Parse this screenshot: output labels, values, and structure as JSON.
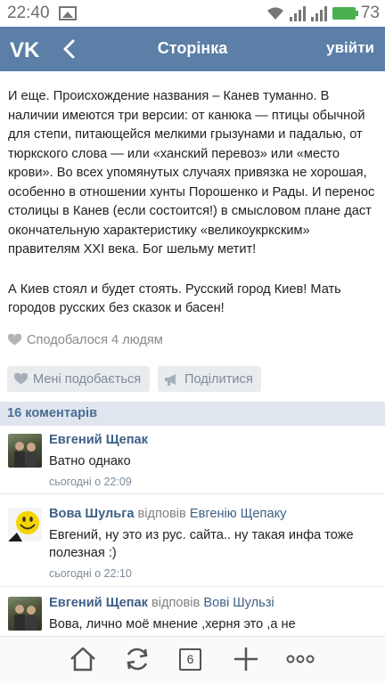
{
  "status_bar": {
    "time": "22:40",
    "battery": "73",
    "icons": [
      "image-icon",
      "wifi-icon",
      "signal-icon",
      "signal-icon",
      "battery-icon"
    ]
  },
  "navbar": {
    "title": "Сторінка",
    "login": "увійти",
    "accent": "#5b7fa6"
  },
  "post": {
    "paragraphs": [
      "И еще. Происхождение названия – Канев туманно. В наличии имеются три версии: от канюка — птицы обычной для степи, питающейся мелкими грызунами и падалью, от тюркского слова — или «ханский перевоз» или «место крови». Во всех упомянутых случаях привязка не хорошая, особенно в отношении хунты Порошенко и Рады. И перенос столицы в Канев (если состоится!) в смысловом плане даст окончательную характеристику «великоукркским» правителям XXI века. Бог шельму метит!",
      "А Киев стоял и будет стоять. Русский город Киев! Мать городов русских без сказок и басен!"
    ],
    "likes_text": "Сподобалося 4 людям"
  },
  "actions": {
    "like_label": "Мені подобається",
    "share_label": "Поділитися"
  },
  "comments": {
    "header": "16 коментарів",
    "items": [
      {
        "author": "Евгений Щепак",
        "reply_word": "",
        "reply_to": "",
        "text": "Ватно однако",
        "time": "сьогодні о 22:09"
      },
      {
        "author": "Вова Шульга",
        "reply_word": "відповів",
        "reply_to": "Евгенію Щепаку",
        "text": "Евгений, ну это из рус. сайта.. ну такая инфа тоже полезная :)",
        "time": "сьогодні о 22:10"
      },
      {
        "author": "Евгений Щепак",
        "reply_word": "відповів",
        "reply_to": "Вові Шульзі",
        "text": "Вова, лично моё мнение ,херня это ,а не",
        "time": ""
      }
    ]
  },
  "bottom_bar": {
    "tabs_count": "6",
    "icons": [
      "home-icon",
      "refresh-icon",
      "tabs-icon",
      "add-icon",
      "menu-dots-icon"
    ]
  }
}
